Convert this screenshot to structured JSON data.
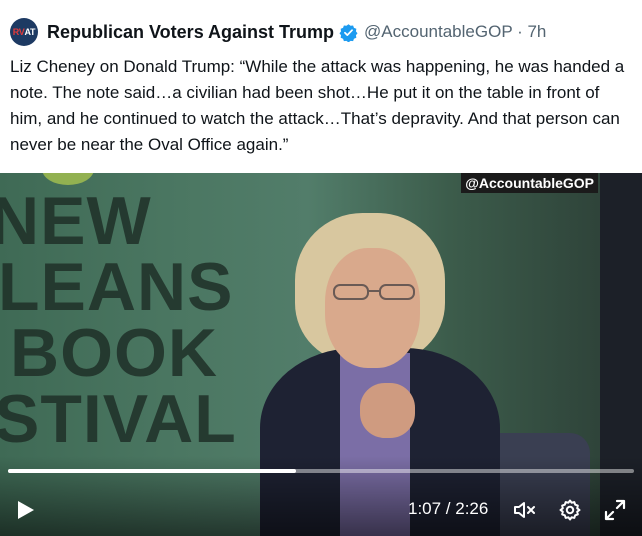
{
  "tweet": {
    "avatar_text_prefix": "RV",
    "avatar_text_suffix": "AT",
    "author_name": "Republican Voters Against Trump",
    "handle_time": "@AccountableGOP · 7h",
    "text": "Liz Cheney on Donald Trump: “While the attack was happening, he was handed a note. The note said…a civilian had been shot…He put it on the table in front of him, and he continued to watch the attack…That’s depravity. And that person can never be near the Oval Office again.”"
  },
  "video": {
    "watermark": "@AccountableGOP",
    "banner_lines": [
      "NEW",
      "LEANS",
      "BOOK",
      "STIVAL"
    ],
    "time_display": "1:07 / 2:26",
    "progress": 0.46,
    "icons": {
      "play": "play-icon",
      "mute": "volume-muted-icon",
      "settings": "gear-icon",
      "fullscreen": "fullscreen-icon",
      "verified": "verified-badge-icon"
    }
  },
  "colors": {
    "verified": "#1d9bf0",
    "text": "#0f1419",
    "secondary": "#536471"
  }
}
